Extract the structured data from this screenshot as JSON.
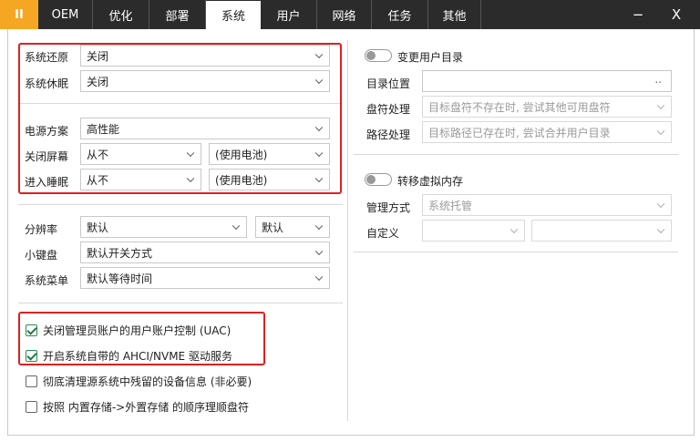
{
  "app_button": "II",
  "tabs": [
    {
      "label": "OEM"
    },
    {
      "label": "优化"
    },
    {
      "label": "部署"
    },
    {
      "label": "系统"
    },
    {
      "label": "用户"
    },
    {
      "label": "网络"
    },
    {
      "label": "任务"
    },
    {
      "label": "其他"
    }
  ],
  "active_tab": "系统",
  "window": {
    "minimize": "−",
    "close": "X"
  },
  "left": {
    "restore": {
      "label": "系统还原",
      "value": "关闭"
    },
    "hibernate": {
      "label": "系统休眠",
      "value": "关闭"
    },
    "power_plan": {
      "label": "电源方案",
      "value": "高性能"
    },
    "screen_off": {
      "label": "关闭屏幕",
      "value": "从不",
      "battery": "(使用电池)"
    },
    "sleep": {
      "label": "进入睡眠",
      "value": "从不",
      "battery": "(使用电池)"
    },
    "resolution": {
      "label": "分辨率",
      "value": "默认",
      "value2": "默认"
    },
    "keypad": {
      "label": "小键盘",
      "value": "默认开关方式"
    },
    "sys_menu": {
      "label": "系统菜单",
      "value": "默认等待时间"
    }
  },
  "checks": [
    {
      "label": "关闭管理员账户的用户账户控制 (UAC)",
      "checked": true
    },
    {
      "label": "开启系统自带的 AHCI/NVME 驱动服务",
      "checked": true
    },
    {
      "label": "彻底清理源系统中残留的设备信息 (非必要)",
      "checked": false
    },
    {
      "label": "按照 内置存储->外置存储 的顺序理顺盘符",
      "checked": false
    }
  ],
  "right": {
    "change_user_dir": {
      "label": "变更用户目录",
      "on": false
    },
    "dir_location": {
      "label": "目录位置",
      "value": "",
      "button": ".."
    },
    "drive_handling": {
      "label": "盘符处理",
      "value": "目标盘符不存在时, 尝试其他可用盘符"
    },
    "path_handling": {
      "label": "路径处理",
      "value": "目标路径已存在时, 尝试合并用户目录"
    },
    "move_vm": {
      "label": "转移虚拟内存",
      "on": false
    },
    "manage_mode": {
      "label": "管理方式",
      "value": "系统托管"
    },
    "custom": {
      "label": "自定义",
      "value": "",
      "value2": ""
    }
  }
}
